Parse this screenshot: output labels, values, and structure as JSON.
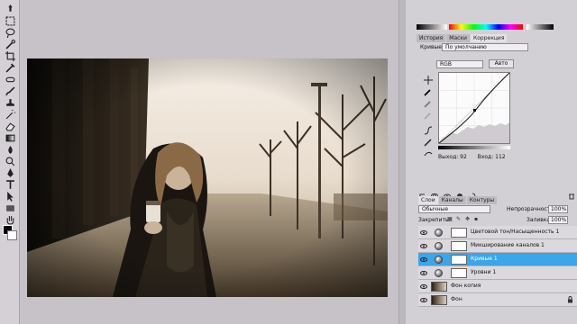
{
  "toolbar": {
    "tools": [
      "move-tool-icon",
      "marquee-tool-icon",
      "lasso-tool-icon",
      "quick-select-tool-icon",
      "crop-tool-icon",
      "eyedropper-tool-icon",
      "healing-brush-tool-icon",
      "brush-tool-icon",
      "clone-stamp-tool-icon",
      "history-brush-tool-icon",
      "eraser-tool-icon",
      "gradient-tool-icon",
      "blur-tool-icon",
      "dodge-tool-icon",
      "pen-tool-icon",
      "type-tool-icon",
      "path-select-tool-icon",
      "shape-tool-icon",
      "3d-rotate-tool-icon",
      "3d-orbit-tool-icon",
      "hand-tool-icon",
      "zoom-tool-icon"
    ],
    "foreground": "#000000",
    "background": "#ffffff"
  },
  "panels": {
    "tabs": [
      "История",
      "Маски",
      "Коррекция"
    ],
    "active_tab": "Коррекция",
    "curves": {
      "title": "Кривые",
      "preset": "По умолчанию",
      "channel": "RGB",
      "auto_label": "Авто",
      "output_label": "Выход: 92",
      "input_label": "Вход: 112"
    }
  },
  "layers_panel": {
    "tabs": [
      "Слои",
      "Каналы",
      "Контуры"
    ],
    "active_tab": "Слои",
    "blend_mode": "Обычные",
    "opacity_label": "Непрозрачность:",
    "opacity_value": "100%",
    "lock_label": "Закрепить:",
    "fill_label": "Заливка:",
    "fill_value": "100%",
    "layers": [
      {
        "name": "Цветовой тон/Насыщенность 1",
        "kind": "adjustment",
        "selected": false
      },
      {
        "name": "Микширование каналов 1",
        "kind": "adjustment",
        "selected": false
      },
      {
        "name": "Кривые 1",
        "kind": "adjustment",
        "selected": true
      },
      {
        "name": "Уровни 1",
        "kind": "adjustment",
        "selected": false
      },
      {
        "name": "Фон копия",
        "kind": "pixel",
        "selected": false
      },
      {
        "name": "Фон",
        "kind": "pixel",
        "selected": false,
        "locked": true
      }
    ]
  },
  "colors": {
    "selection": "#3da5ea",
    "panel_bg": "#d3d0d5",
    "canvas_bg": "#c6c2c8"
  }
}
